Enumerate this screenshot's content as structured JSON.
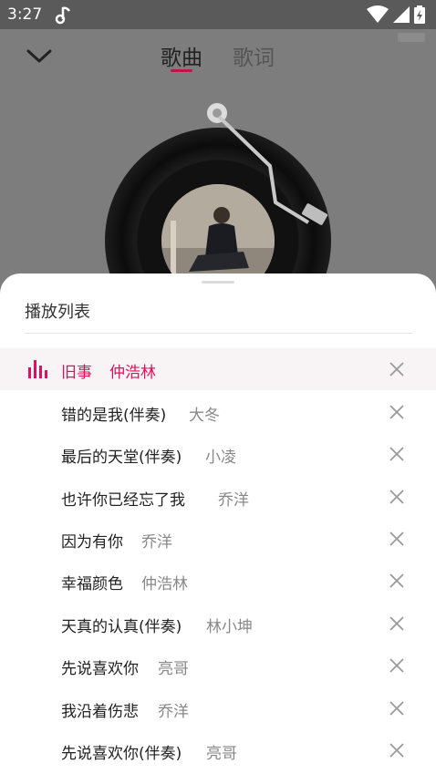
{
  "status_bar": {
    "time": "3:27",
    "icons": [
      "music-note-icon",
      "wifi-icon",
      "signal-icon",
      "battery-icon"
    ]
  },
  "header": {
    "tabs": [
      {
        "label": "歌曲",
        "active": true
      },
      {
        "label": "歌词",
        "active": false
      }
    ]
  },
  "playlist": {
    "title": "播放列表",
    "accent_color": "#e1105c",
    "items": [
      {
        "song": "旧事",
        "artist": "仲浩林",
        "playing": true
      },
      {
        "song": "错的是我(伴奏)",
        "artist": "大冬"
      },
      {
        "song": "最后的天堂(伴奏)",
        "artist": "小凌"
      },
      {
        "song": "也许你已经忘了我",
        "artist": "乔洋"
      },
      {
        "song": "因为有你",
        "artist": "乔洋"
      },
      {
        "song": "幸福颜色",
        "artist": "仲浩林"
      },
      {
        "song": "天真的认真(伴奏)",
        "artist": "林小坤"
      },
      {
        "song": "先说喜欢你",
        "artist": "亮哥"
      },
      {
        "song": "我沿着伤悲",
        "artist": "乔洋"
      },
      {
        "song": "先说喜欢你(伴奏)",
        "artist": "亮哥"
      }
    ]
  }
}
